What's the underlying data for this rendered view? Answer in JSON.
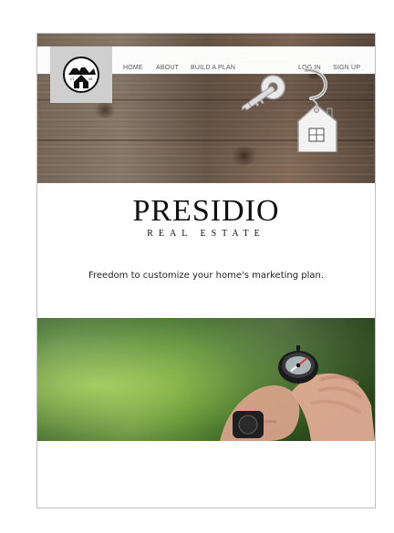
{
  "nav": {
    "items": [
      {
        "label": "HOME"
      },
      {
        "label": "ABOUT"
      },
      {
        "label": "BUILD A PLAN"
      },
      {
        "label": "LOG IN"
      },
      {
        "label": "SIGN UP"
      }
    ]
  },
  "brand": {
    "name": "PRESIDIO",
    "subtitle": "REAL ESTATE"
  },
  "hero": {
    "tagline": "Freedom to customize your home's marketing plan."
  },
  "icons": {
    "logo": "mountain-house-logo-icon",
    "keys": "house-keychain-icon",
    "compass": "compass-hands-image"
  },
  "colors": {
    "nav_text": "#555555",
    "logo_bg": "#cfcfcf",
    "frame_border": "#bdbdbd"
  }
}
